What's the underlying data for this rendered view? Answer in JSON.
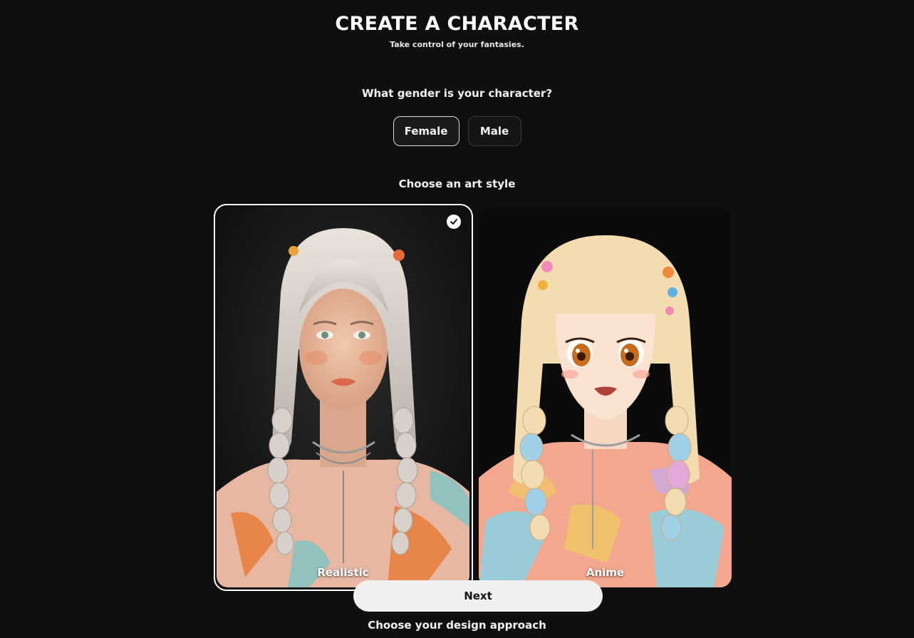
{
  "header": {
    "title": "CREATE A CHARACTER",
    "subtitle": "Take control of your fantasies."
  },
  "gender": {
    "question": "What gender is your character?",
    "options": [
      {
        "label": "Female",
        "selected": true
      },
      {
        "label": "Male",
        "selected": false
      }
    ]
  },
  "art_style": {
    "question": "Choose an art style",
    "options": [
      {
        "label": "Realistic",
        "selected": true
      },
      {
        "label": "Anime",
        "selected": false
      }
    ]
  },
  "actions": {
    "next_label": "Next"
  },
  "next_section": {
    "question": "Choose your design approach"
  },
  "colors": {
    "background": "#0f0f0f",
    "selected_border": "#ffffff",
    "button_bg": "#f0f0f0"
  },
  "icons": {
    "selected_check": "check-circle-icon"
  }
}
